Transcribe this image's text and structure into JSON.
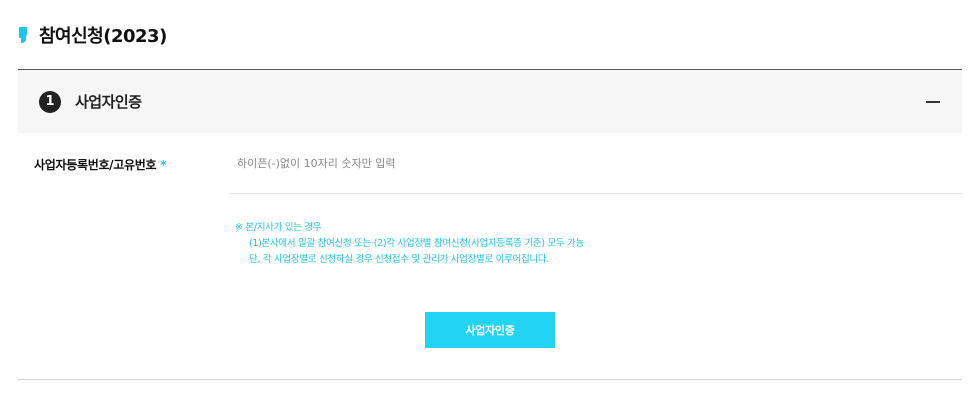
{
  "page": {
    "title": "참여신청(2023)"
  },
  "section": {
    "step_number": "1",
    "title": "사업자인증",
    "collapse_symbol": "—"
  },
  "business_field": {
    "label": "사업자등록번호/고유번호",
    "required_mark": "*",
    "placeholder": "하이픈(-)없이 10자리 숫자만 입력",
    "value": ""
  },
  "notice": {
    "line1": "※ 본/지사가 있는 경우",
    "line2": "(1)본사에서 일괄 참여신청 또는 (2)각 사업장별 참여신청(사업자등록증 기준) 모두 가능",
    "line3": "단, 각 사업장별로 신청하실 경우 신청접수 및 관리가 사업장별로 이루어집니다."
  },
  "verify_button": {
    "label": "사업자인증"
  },
  "colors": {
    "accent": "#22c3e6",
    "button": "#22d3f3",
    "header_bg": "#f6f6f6"
  }
}
